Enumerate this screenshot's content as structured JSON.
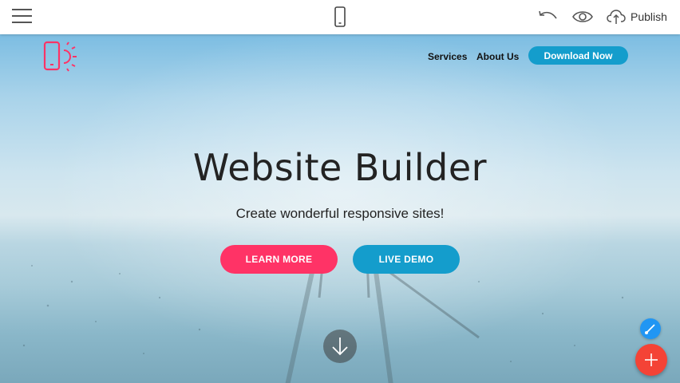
{
  "toolbar": {
    "menu_icon": "hamburger-menu-icon",
    "device_icon": "mobile-phone-icon",
    "undo_icon": "undo-icon",
    "preview_icon": "eye-icon",
    "publish_icon": "cloud-upload-icon",
    "publish_label": "Publish"
  },
  "site": {
    "logo_icon": "phone-sun-logo",
    "nav": {
      "services": "Services",
      "about": "About Us",
      "download": "Download Now"
    },
    "hero": {
      "title": "Website Builder",
      "subtitle": "Create wonderful responsive sites!",
      "learn_more": "LEARN MORE",
      "live_demo": "LIVE DEMO",
      "scroll_icon": "arrow-down-icon"
    }
  },
  "floating": {
    "brush_icon": "paint-brush-icon",
    "add_icon": "plus-icon"
  },
  "colors": {
    "accent_pink": "#ff3366",
    "accent_blue": "#149dcc",
    "fab_red": "#f44336",
    "fab_blue": "#2196f3"
  }
}
